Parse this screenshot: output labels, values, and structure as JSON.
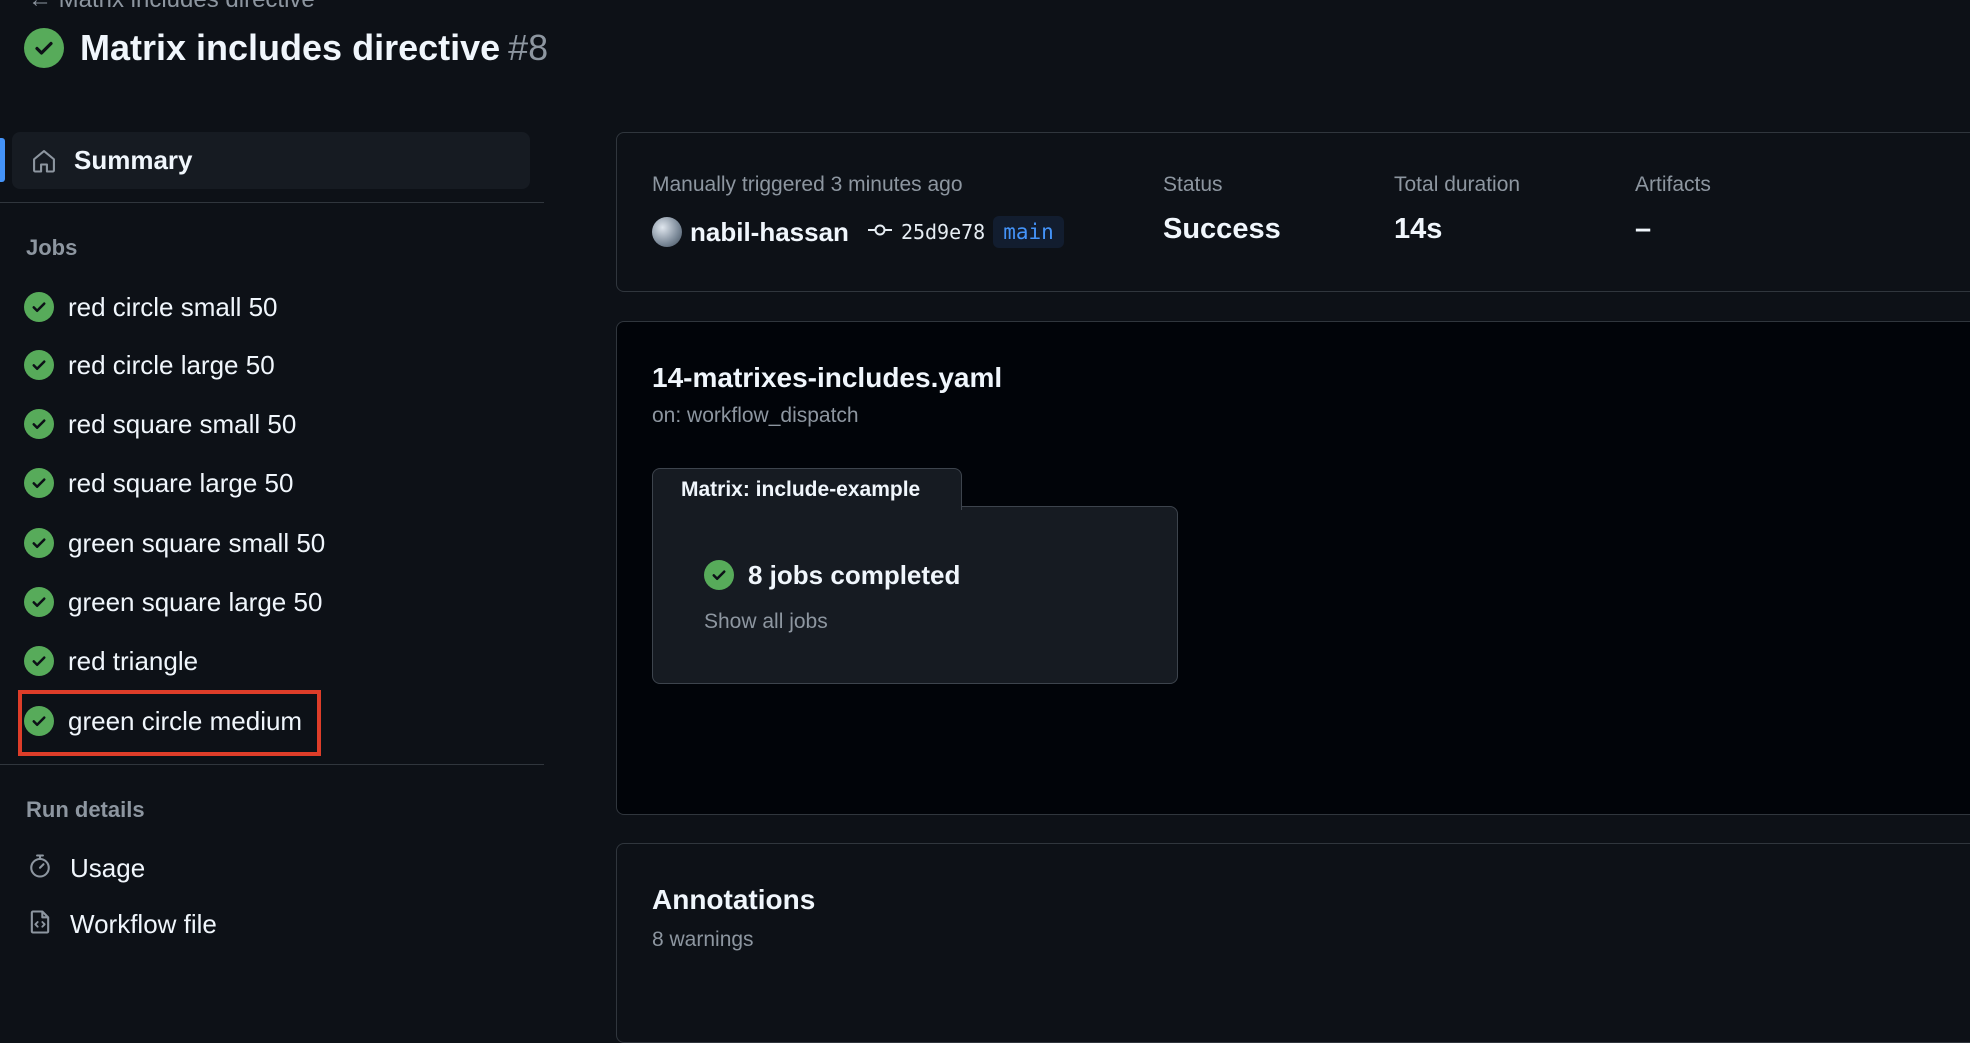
{
  "header": {
    "breadcrumb": "← Matrix includes directive",
    "title": "Matrix includes directive",
    "run_number": "#8"
  },
  "sidebar": {
    "summary_label": "Summary",
    "jobs_heading": "Jobs",
    "jobs": [
      {
        "label": "red circle small 50",
        "status": "success"
      },
      {
        "label": "red circle large 50",
        "status": "success"
      },
      {
        "label": "red square small 50",
        "status": "success"
      },
      {
        "label": "red square large 50",
        "status": "success"
      },
      {
        "label": "green square small 50",
        "status": "success"
      },
      {
        "label": "green square large 50",
        "status": "success"
      },
      {
        "label": "red triangle",
        "status": "success"
      },
      {
        "label": "green circle medium",
        "status": "success",
        "highlighted": true
      }
    ],
    "run_details_heading": "Run details",
    "run_details": [
      {
        "label": "Usage",
        "icon": "stopwatch-icon"
      },
      {
        "label": "Workflow file",
        "icon": "file-code-icon"
      }
    ]
  },
  "run_summary": {
    "trigger_text": "Manually triggered 3 minutes ago",
    "actor": "nabil-hassan",
    "commit_sha": "25d9e78",
    "branch": "main",
    "status_label": "Status",
    "status_value": "Success",
    "duration_label": "Total duration",
    "duration_value": "14s",
    "artifacts_label": "Artifacts",
    "artifacts_value": "–"
  },
  "workflow": {
    "file_name": "14-matrixes-includes.yaml",
    "trigger": "on: workflow_dispatch",
    "matrix_label": "Matrix: include-example",
    "jobs_completed": "8 jobs completed",
    "show_all": "Show all jobs"
  },
  "annotations": {
    "title": "Annotations",
    "count_text": "8 warnings"
  },
  "colors": {
    "background": "#0d1117",
    "success": "#57ab5a",
    "accent": "#4493f8",
    "highlight_border": "#dd3d29"
  }
}
